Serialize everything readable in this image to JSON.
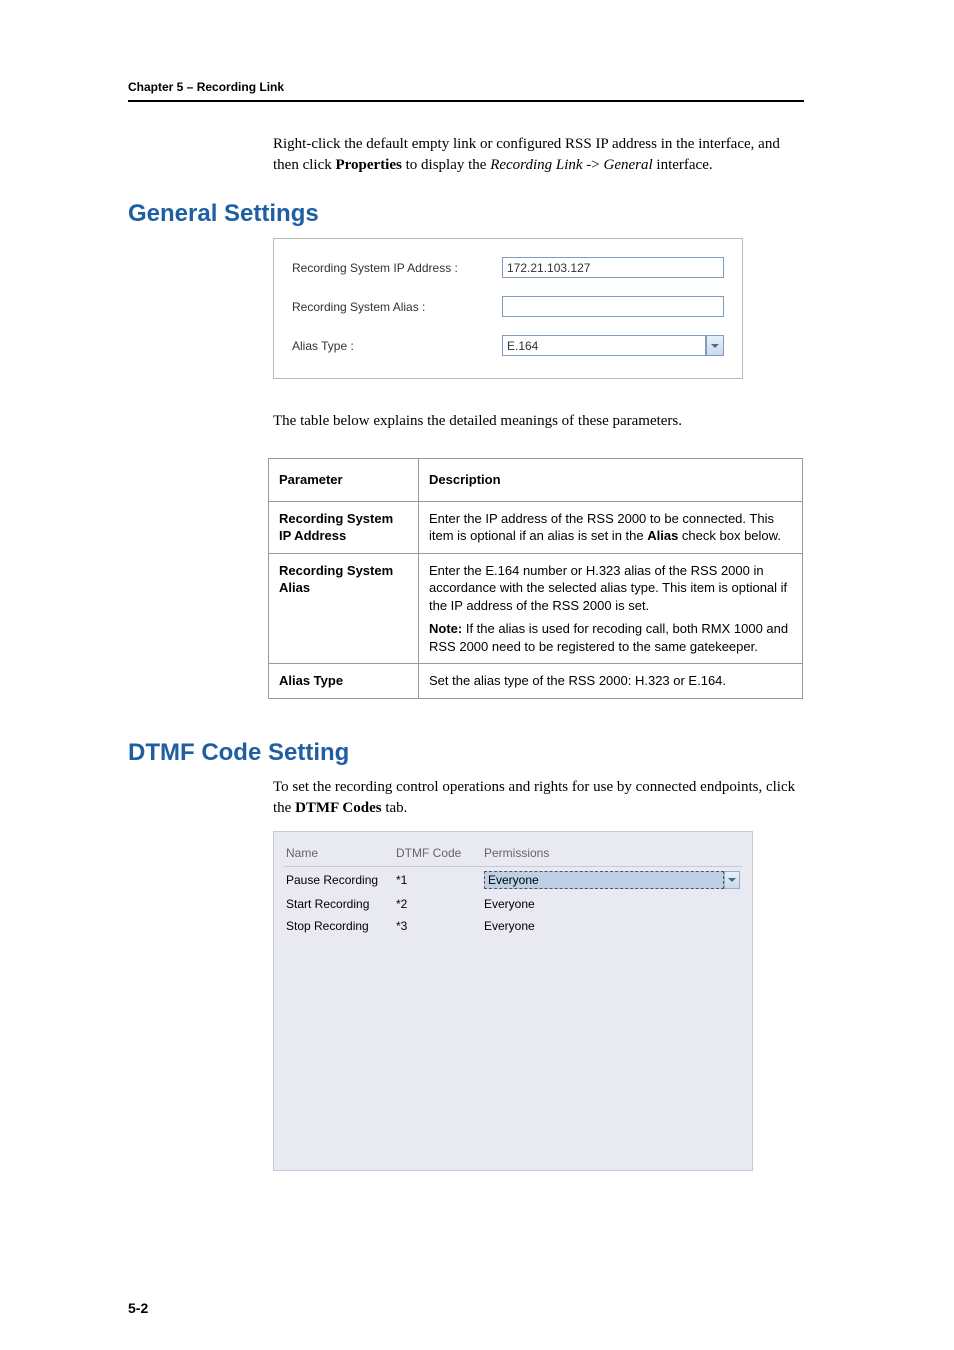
{
  "header": {
    "chapter": "Chapter 5 – Recording Link"
  },
  "intro": {
    "part1": "Right-click the default empty link or configured RSS IP address in the interface, and then click ",
    "bold1": "Properties",
    "part2": " to display the ",
    "italic1": "Recording Link",
    "part3": " -> ",
    "italic2": "General",
    "part4": " interface."
  },
  "section1_heading": "General Settings",
  "form": {
    "ip_label": "Recording System IP Address :",
    "ip_value": "172.21.103.127",
    "alias_label": "Recording System Alias :",
    "alias_value": "",
    "type_label": "Alias Type :",
    "type_value": "E.164"
  },
  "table_intro": "The table below explains the detailed meanings of these parameters.",
  "param_table": {
    "hdr_param": "Parameter",
    "hdr_desc": "Description",
    "rows": [
      {
        "label": "Recording System IP Address",
        "desc_a": "Enter the IP address of the RSS 2000 to be connected. This item is optional if an alias is set in the ",
        "desc_b": "Alias",
        "desc_c": " check box below."
      },
      {
        "label": "Recording System Alias",
        "desc_a": "Enter the E.164 number or H.323 alias of the RSS 2000 in accordance with the selected alias type. This item is optional if the IP address of the RSS 2000 is set.",
        "note_label": "Note:",
        "note_text": " If the alias is used for recoding call, both RMX 1000 and RSS 2000 need to be registered to the same gatekeeper."
      },
      {
        "label": "Alias Type",
        "desc_a": "Set the alias type of the RSS 2000: H.323 or E.164."
      }
    ]
  },
  "section2_heading": "DTMF Code Setting",
  "dtmf_intro": {
    "part1": "To set the recording control operations and rights for use by connected endpoints, click the ",
    "bold1": "DTMF Codes",
    "part2": " tab."
  },
  "dtmf_table": {
    "hdr_name": "Name",
    "hdr_code": "DTMF Code",
    "hdr_perm": "Permissions",
    "rows": [
      {
        "name": "Pause Recording",
        "code": "*1",
        "perm": "Everyone",
        "selected": true
      },
      {
        "name": "Start Recording",
        "code": "*2",
        "perm": "Everyone",
        "selected": false
      },
      {
        "name": "Stop Recording",
        "code": "*3",
        "perm": "Everyone",
        "selected": false
      }
    ]
  },
  "page_number": "5-2"
}
